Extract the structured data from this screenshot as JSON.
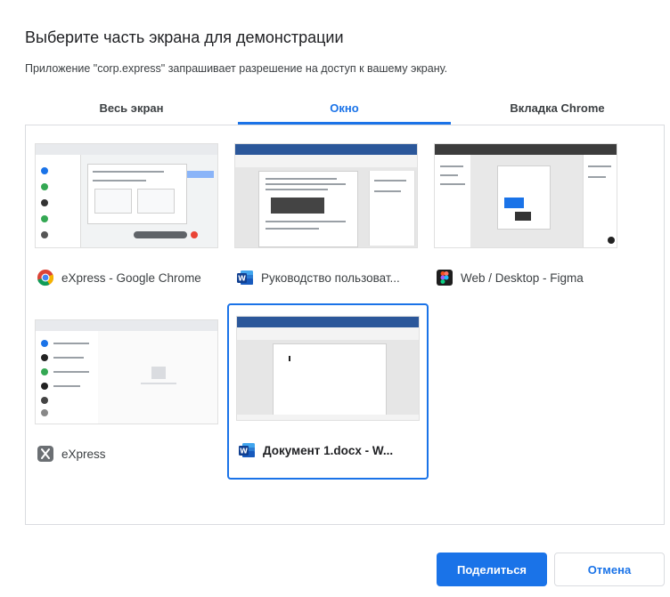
{
  "dialog": {
    "title": "Выберите часть экрана для демонстрации",
    "subtitle": "Приложение \"corp.express\" запрашивает разрешение на доступ к вашему экрану."
  },
  "tabs": [
    {
      "label": "Весь экран",
      "active": false
    },
    {
      "label": "Окно",
      "active": true
    },
    {
      "label": "Вкладка Chrome",
      "active": false
    }
  ],
  "windows": [
    {
      "label": "eXpress - Google Chrome",
      "icon": "chrome-icon",
      "selected": false
    },
    {
      "label": "Руководство пользоват...",
      "icon": "word-icon",
      "selected": false
    },
    {
      "label": "Web / Desktop - Figma",
      "icon": "figma-icon",
      "selected": false
    },
    {
      "label": "eXpress",
      "icon": "express-icon",
      "selected": false
    },
    {
      "label": "Документ 1.docx - W...",
      "icon": "word-icon",
      "selected": true
    }
  ],
  "buttons": {
    "share": "Поделиться",
    "cancel": "Отмена"
  },
  "colors": {
    "accent": "#1a73e8",
    "word_blue": "#2b579a",
    "border": "#dadce0"
  }
}
